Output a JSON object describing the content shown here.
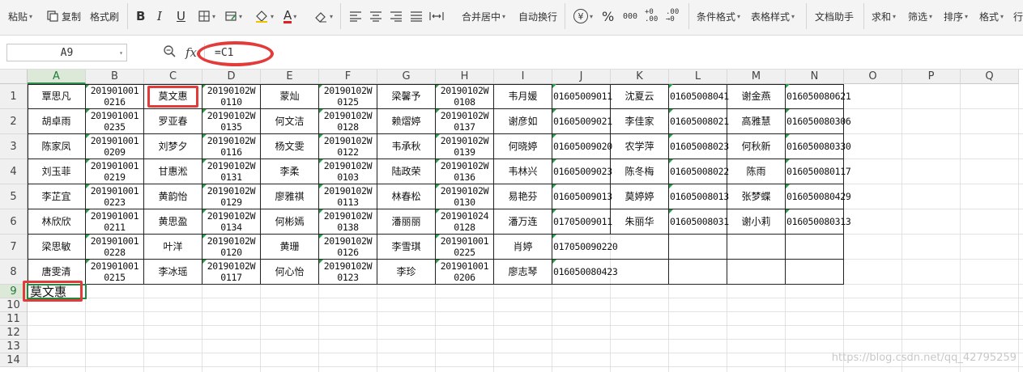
{
  "ribbon": {
    "paste": "粘贴",
    "copy": "复制",
    "format_painter": "格式刷",
    "merge_center": "合并居中",
    "wrap_text": "自动换行",
    "percent": "%",
    "cond_format": "条件格式",
    "table_style": "表格样式",
    "doc_helper": "文档助手",
    "sum": "求和",
    "filter": "筛选",
    "sort": "排序",
    "format": "格式",
    "rows": "行"
  },
  "formula_bar": {
    "name_box": "A9",
    "fx": "fx",
    "formula": "=C1"
  },
  "grid": {
    "columns": [
      "A",
      "B",
      "C",
      "D",
      "E",
      "F",
      "G",
      "H",
      "I",
      "J",
      "K",
      "L",
      "M",
      "N",
      "O",
      "P",
      "Q"
    ],
    "row_numbers": [
      "1",
      "2",
      "3",
      "4",
      "5",
      "6",
      "7",
      "8",
      "9",
      "10",
      "11",
      "12",
      "13",
      "14"
    ],
    "rows": [
      [
        "覃思凡",
        "201901001\n0216",
        "莫文惠",
        "20190102W\n0110",
        "蒙灿",
        "20190102W\n0125",
        "梁馨予",
        "20190102W\n0108",
        "韦月媛",
        "01605009011",
        "沈夏云",
        "01605008041",
        "谢金燕",
        "016050080621"
      ],
      [
        "胡卓雨",
        "201901001\n0235",
        "罗亚春",
        "20190102W\n0135",
        "何文洁",
        "20190102W\n0128",
        "赖熠婷",
        "20190102W\n0137",
        "谢彦如",
        "01605009021",
        "李佳家",
        "01605008021",
        "高雅慧",
        "016050080306"
      ],
      [
        "陈家凤",
        "201901001\n0209",
        "刘梦夕",
        "20190102W\n0116",
        "杨文雯",
        "20190102W\n0122",
        "韦承秋",
        "20190102W\n0139",
        "何晓婷",
        "01605009020",
        "农学萍",
        "01605008023",
        "何秋新",
        "016050080330"
      ],
      [
        "刘玉菲",
        "201901001\n0219",
        "甘惠淞",
        "20190102W\n0131",
        "李柔",
        "20190102W\n0103",
        "陆政荣",
        "20190102W\n0136",
        "韦林兴",
        "01605009023",
        "陈冬梅",
        "01605008022",
        "陈雨",
        "016050080117"
      ],
      [
        "李芷宜",
        "201901001\n0223",
        "黄韵怡",
        "20190102W\n0129",
        "廖雅祺",
        "20190102W\n0113",
        "林春松",
        "20190102W\n0130",
        "易艳芬",
        "01605009013",
        "莫婷婷",
        "01605008013",
        "张梦蝶",
        "016050080429"
      ],
      [
        "林欣欣",
        "201901001\n0211",
        "黄思盈",
        "20190102W\n0134",
        "何彬嫣",
        "20190102W\n0138",
        "潘丽丽",
        "201901024\n0128",
        "潘万连",
        "01705009011",
        "朱丽华",
        "01605008031",
        "谢小莉",
        "016050080313"
      ],
      [
        "梁思敏",
        "201901001\n0228",
        "叶洋",
        "20190102W\n0120",
        "黄珊",
        "20190102W\n0126",
        "李雪琪",
        "201901001\n0225",
        "肖婷",
        "017050090220",
        "",
        "",
        "",
        ""
      ],
      [
        "唐雯清",
        "201901001\n0215",
        "李冰瑶",
        "20190102W\n0117",
        "何心怡",
        "20190102W\n0123",
        "李珍",
        "201901001\n0206",
        "廖志琴",
        "016050080423",
        "",
        "",
        "",
        ""
      ]
    ],
    "active_value": "莫文惠"
  },
  "watermark": "https://blog.csdn.net/qq_42795259"
}
